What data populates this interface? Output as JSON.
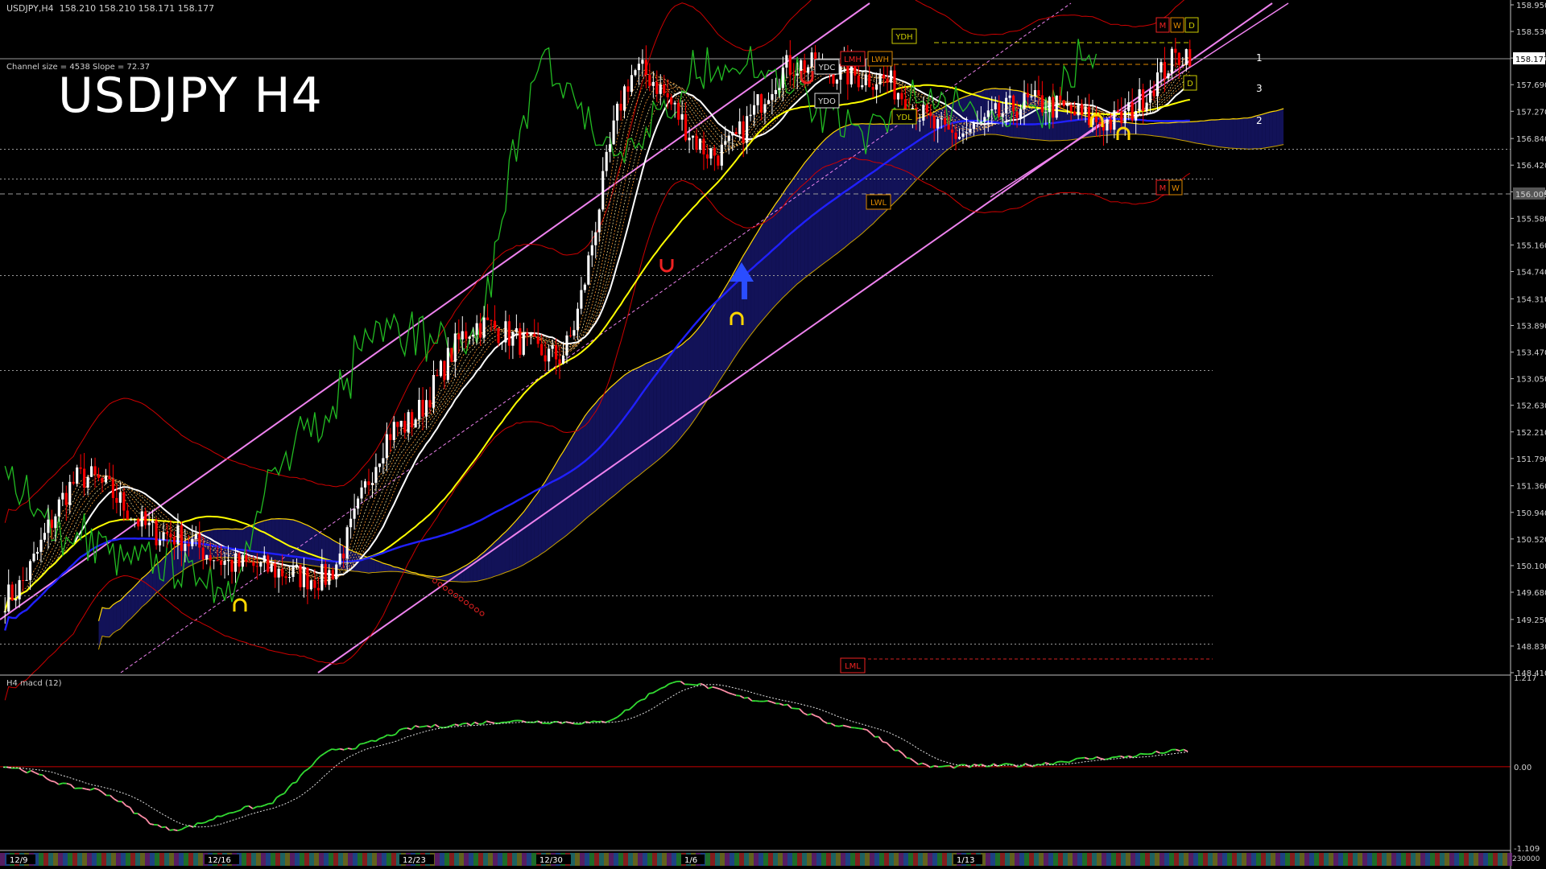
{
  "header": {
    "symbol_tf": "USDJPY,H4",
    "ohlc": "158.210 158.210 158.171 158.177",
    "channel_info": "Channel size = 4538 Slope = 72.37",
    "big_title": "USDJPY H4",
    "indicator_label": "H4 macd (12)"
  },
  "chart_data": [
    {
      "type": "candlestick",
      "title": "USDJPY H4",
      "ylim": [
        148.41,
        158.95
      ],
      "y_ticks": [
        "158.950",
        "158.530",
        "158.110",
        "157.690",
        "157.270",
        "156.840",
        "156.420",
        "156.000",
        "155.580",
        "155.160",
        "154.740",
        "154.310",
        "153.890",
        "153.470",
        "153.050",
        "152.630",
        "152.210",
        "151.790",
        "151.360",
        "150.940",
        "150.520",
        "150.100",
        "149.680",
        "149.250",
        "148.830",
        "148.410"
      ],
      "current_price": "158.177",
      "marked_price": "156.009",
      "x_labels": [
        "12/9",
        "12/16",
        "12/23",
        "12/30",
        "1/6",
        "1/13"
      ],
      "close_path": [
        149.6,
        151.5,
        150.6,
        150.1,
        149.9,
        152.3,
        153.9,
        153.4,
        157.9,
        156.6,
        158.0,
        157.8,
        156.9,
        157.4,
        157.1,
        158.2
      ],
      "level_labels": [
        "YDH",
        "YDC",
        "YDO",
        "YDL",
        "LMH",
        "LWH",
        "LWL",
        "LML",
        "M",
        "W",
        "D"
      ],
      "channel_labels": [
        "1",
        "3",
        "2"
      ]
    },
    {
      "type": "line",
      "title": "H4 macd (12)",
      "ylim": [
        -1.109,
        1.217
      ],
      "y_ticks": [
        "1.217",
        "0.00",
        "-1.109"
      ],
      "extra_label": "230000",
      "series_values": [
        0.0,
        -0.3,
        -0.85,
        -0.55,
        0.25,
        0.55,
        0.62,
        0.6,
        1.15,
        0.9,
        0.55,
        0.0,
        0.02,
        0.12,
        0.22
      ]
    }
  ],
  "colors": {
    "background": "#000000",
    "bull": "#ffffff",
    "bear": "#ff0000",
    "channel": "#ee82ee",
    "ma_white": "#ffffff",
    "ma_yellow": "#ffff00",
    "ma_blue": "#2020ff",
    "macd_up": "#33dd33",
    "macd_down": "#ff8fa8",
    "ichimoku_span": "#ffd700",
    "cloud_bull": "#2020a0",
    "cloud_bear": "#a02020"
  }
}
